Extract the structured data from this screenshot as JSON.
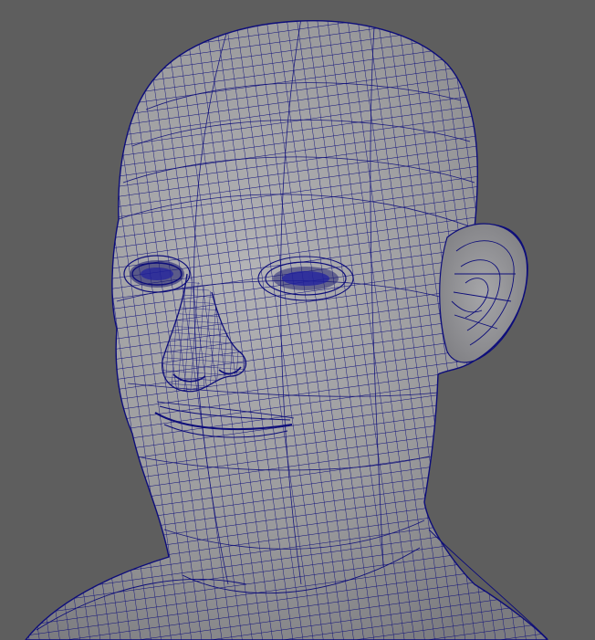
{
  "viewport": {
    "background_color": "#5e5e5e",
    "mesh_fill_color": "#9a9a9c",
    "wire_color": "#0d0d7a",
    "subject": "wireframe-head-mesh",
    "display_mode": "shaded-with-wireframe"
  }
}
